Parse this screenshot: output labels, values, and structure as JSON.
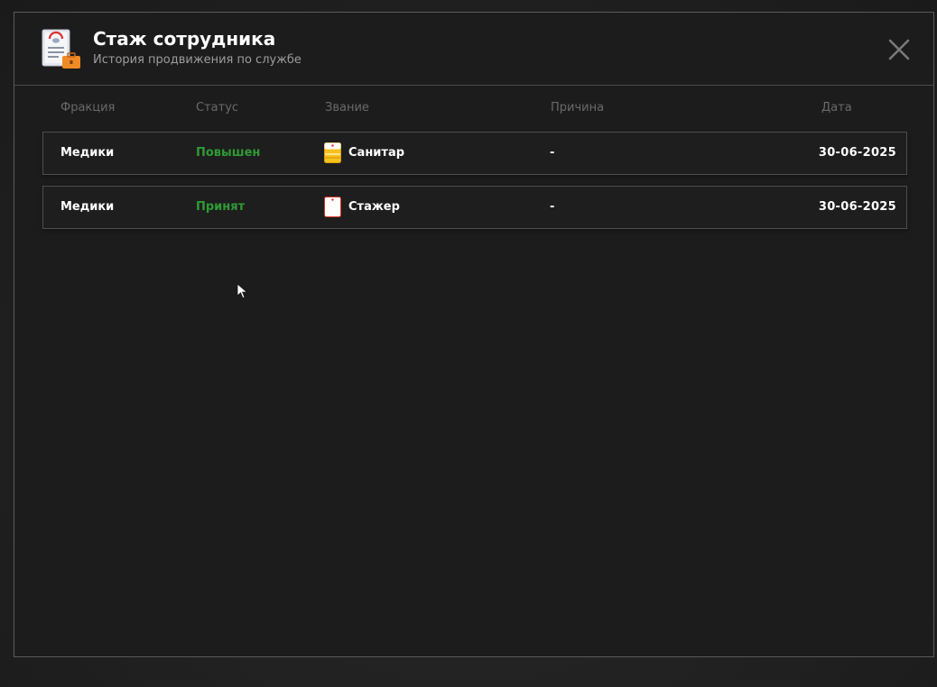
{
  "window": {
    "title": "Стаж сотрудника",
    "subtitle": "История продвижения по службе",
    "header_icon": "document-briefcase-icon",
    "close_icon": "close-icon"
  },
  "columns": {
    "faction": "Фракция",
    "status": "Статус",
    "rank": "Звание",
    "reason": "Причина",
    "date": "Дата"
  },
  "rows": [
    {
      "faction": "Медики",
      "status": "Повышен",
      "rank_icon": "rank-yellow-badge-icon",
      "rank": "Санитар",
      "reason": "-",
      "date": "30-06-2025"
    },
    {
      "faction": "Медики",
      "status": "Принят",
      "rank_icon": "rank-white-badge-icon",
      "rank": "Стажер",
      "reason": "-",
      "date": "30-06-2025"
    }
  ],
  "colors": {
    "status_green": "#2f9a35",
    "text_white": "#ffffff",
    "header_muted": "#6a6a6a",
    "border": "#4e4e4e",
    "background": "#1c1c1c"
  }
}
